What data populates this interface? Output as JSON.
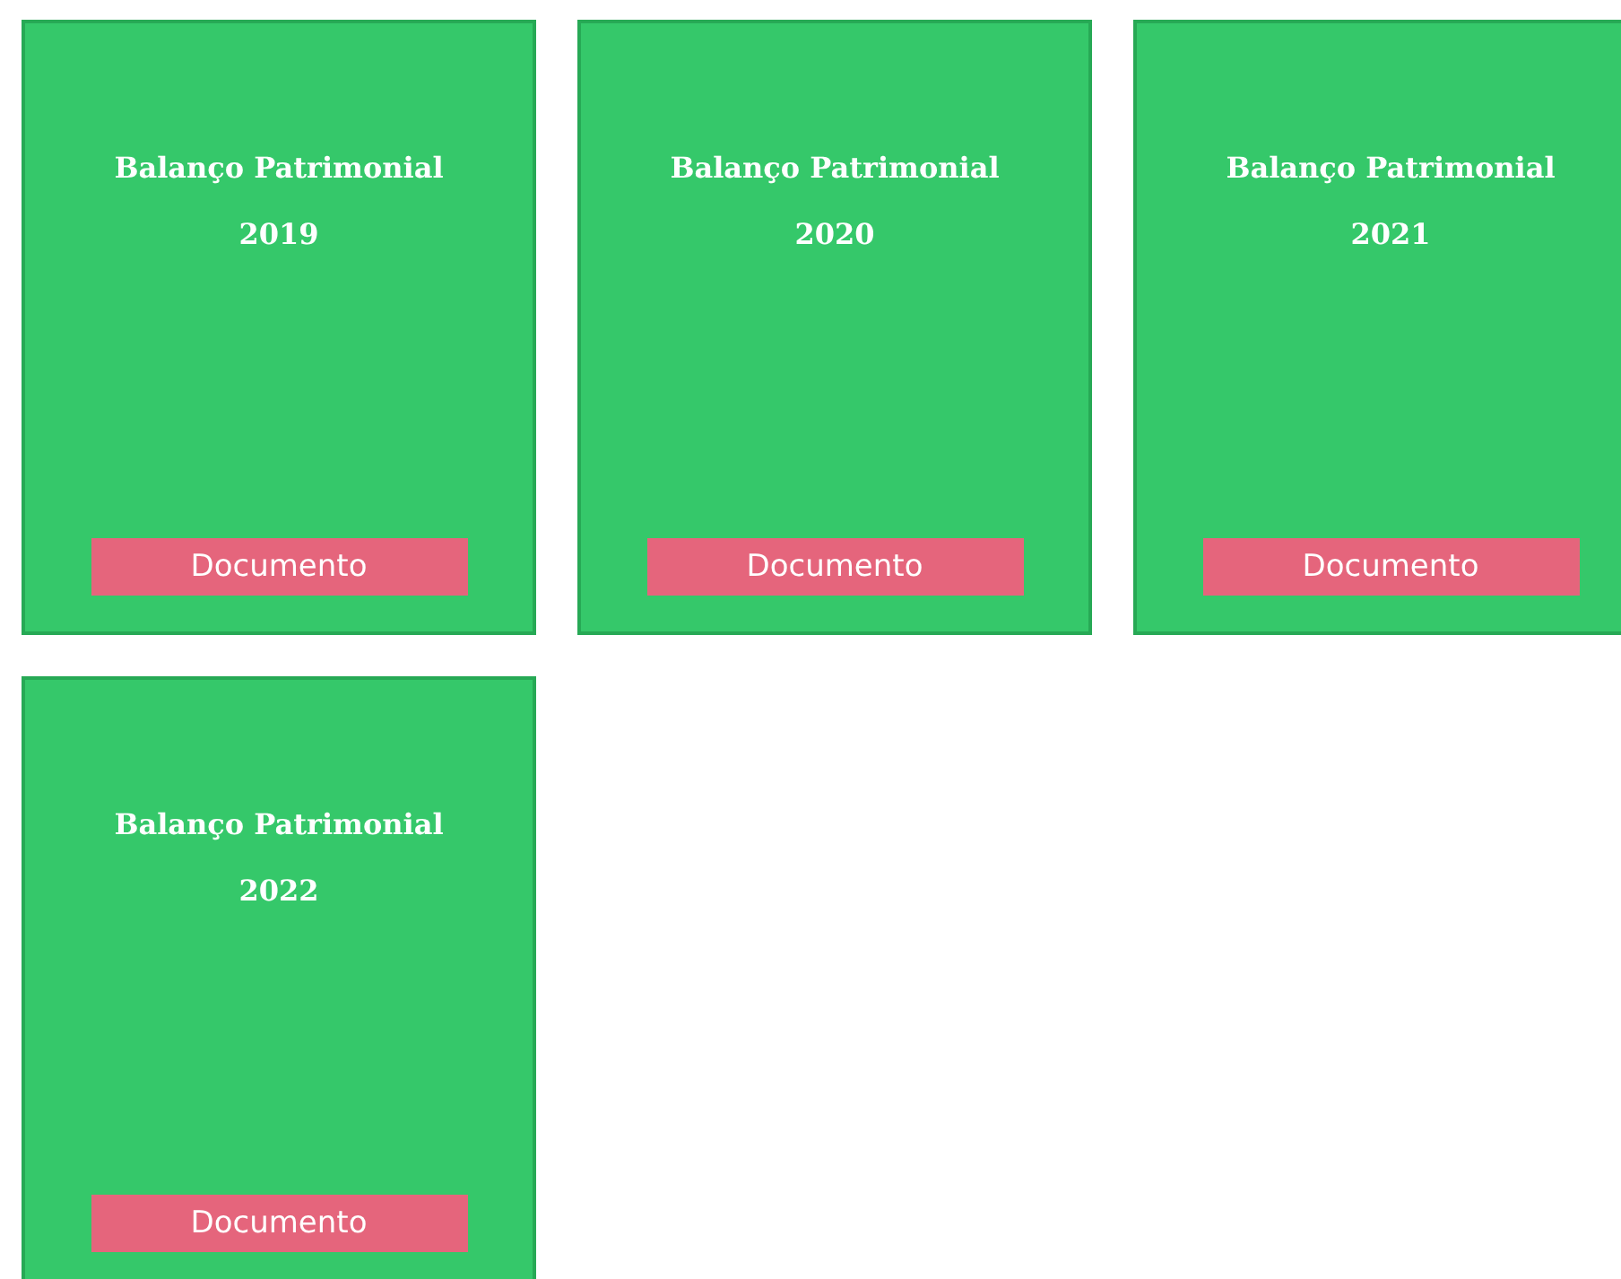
{
  "cards": [
    {
      "title": "Balanço Patrimonial",
      "year": "2019",
      "button": "Documento"
    },
    {
      "title": "Balanço Patrimonial",
      "year": "2020",
      "button": "Documento"
    },
    {
      "title": "Balanço Patrimonial",
      "year": "2021",
      "button": "Documento"
    },
    {
      "title": "Balanço Patrimonial",
      "year": "2022",
      "button": "Documento"
    }
  ]
}
